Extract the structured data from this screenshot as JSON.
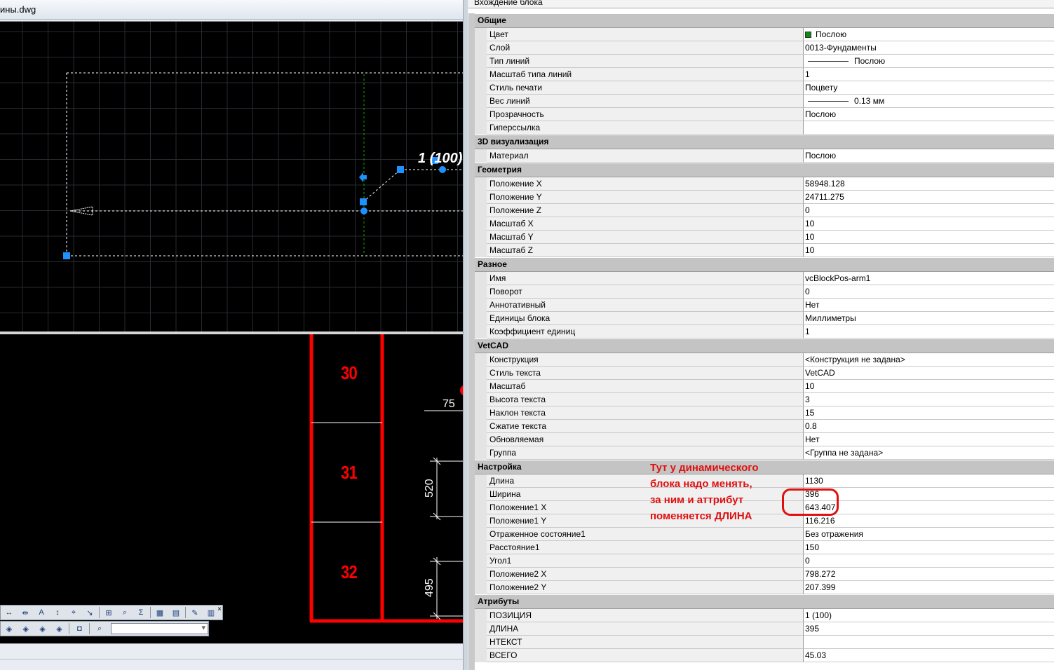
{
  "window": {
    "title": "ины.dwg"
  },
  "drawing": {
    "top_viewport": {
      "block_label": "1 (100)"
    },
    "bottom_viewport": {
      "numbers": [
        "30",
        "31",
        "32"
      ],
      "dimensions": [
        "75",
        "520",
        "495"
      ]
    }
  },
  "colors": {
    "canvas_bg": "#000000",
    "cad_red": "#ff0000",
    "grip_blue": "#1e90ff",
    "annotation_red": "#e01010",
    "category_bg": "#c4c4c4",
    "layer_green": "#108a10"
  },
  "palette": {
    "header": "Вхождение блока",
    "categories": [
      {
        "name": "Общие",
        "rows": [
          {
            "name": "Цвет",
            "value": "Послою",
            "icon": "color-swatch-icon"
          },
          {
            "name": "Слой",
            "value": "0013-Фундаменты"
          },
          {
            "name": "Тип линий",
            "value": "Послою",
            "icon": "line-sample-icon"
          },
          {
            "name": "Масштаб типа линий",
            "value": "1"
          },
          {
            "name": "Стиль печати",
            "value": "Поцвету"
          },
          {
            "name": "Вес линий",
            "value": "0.13 мм",
            "icon": "line-sample-icon"
          },
          {
            "name": "Прозрачность",
            "value": "Послою"
          },
          {
            "name": "Гиперссылка",
            "value": ""
          }
        ]
      },
      {
        "name": "3D визуализация",
        "rows": [
          {
            "name": "Материал",
            "value": "Послою"
          }
        ]
      },
      {
        "name": "Геометрия",
        "rows": [
          {
            "name": "Положение X",
            "value": "58948.128"
          },
          {
            "name": "Положение Y",
            "value": "24711.275"
          },
          {
            "name": "Положение Z",
            "value": "0"
          },
          {
            "name": "Масштаб X",
            "value": "10"
          },
          {
            "name": "Масштаб Y",
            "value": "10"
          },
          {
            "name": "Масштаб Z",
            "value": "10"
          }
        ]
      },
      {
        "name": "Разное",
        "rows": [
          {
            "name": "Имя",
            "value": "vcBlockPos-arm1"
          },
          {
            "name": "Поворот",
            "value": "0"
          },
          {
            "name": "Аннотативный",
            "value": "Нет"
          },
          {
            "name": "Единицы блока",
            "value": "Миллиметры"
          },
          {
            "name": "Коэффициент единиц",
            "value": "1"
          }
        ]
      },
      {
        "name": "VetCAD",
        "rows": [
          {
            "name": "Конструкция",
            "value": "<Конструкция не задана>"
          },
          {
            "name": "Стиль текста",
            "value": "VetCAD"
          },
          {
            "name": "Масштаб",
            "value": "10"
          },
          {
            "name": "Высота текста",
            "value": "3"
          },
          {
            "name": "Наклон текста",
            "value": "15"
          },
          {
            "name": "Сжатие текста",
            "value": "0.8"
          },
          {
            "name": "Обновляемая",
            "value": "Нет"
          },
          {
            "name": "Группа",
            "value": "<Группа не задана>"
          }
        ]
      },
      {
        "name": "Настройка",
        "rows": [
          {
            "name": "Длина",
            "value": "1130"
          },
          {
            "name": "Ширина",
            "value": "396"
          },
          {
            "name": "Положение1 X",
            "value": "643.407"
          },
          {
            "name": "Положение1 Y",
            "value": "116.216"
          },
          {
            "name": "Отраженное состояние1",
            "value": "Без отражения"
          },
          {
            "name": "Расстояние1",
            "value": "150"
          },
          {
            "name": "Угол1",
            "value": "0"
          },
          {
            "name": "Положение2 X",
            "value": "798.272"
          },
          {
            "name": "Положение2 Y",
            "value": "207.399"
          }
        ]
      },
      {
        "name": "Атрибуты",
        "rows": [
          {
            "name": "ПОЗИЦИЯ",
            "value": "1 (100)"
          },
          {
            "name": "ДЛИНА",
            "value": "395"
          },
          {
            "name": "НТЕКСТ",
            "value": ""
          },
          {
            "name": "ВСЕГО",
            "value": "45.03"
          }
        ]
      }
    ]
  },
  "annotation": {
    "lines": [
      "Тут у динамического",
      "блока надо менять,",
      "за ним и аттрибут",
      "поменяется ДЛИНА"
    ]
  },
  "toolbar": {
    "row1_icons": [
      "dimension-linear-icon",
      "dimension-break-icon",
      "text-style-icon",
      "dimension-arrow-icon",
      "tolerance-icon",
      "leader-icon",
      "zoom-window-icon",
      "magnify-icon",
      "sum-icon",
      "table-icon",
      "table-edit-icon",
      "properties-icon",
      "grid-table-icon"
    ],
    "row2_icons": [
      "view-iso1-icon",
      "view-iso2-icon",
      "view-iso3-icon",
      "view-iso4-icon",
      "camera-icon",
      "zoom-realtime-icon"
    ],
    "combo_value": ""
  }
}
